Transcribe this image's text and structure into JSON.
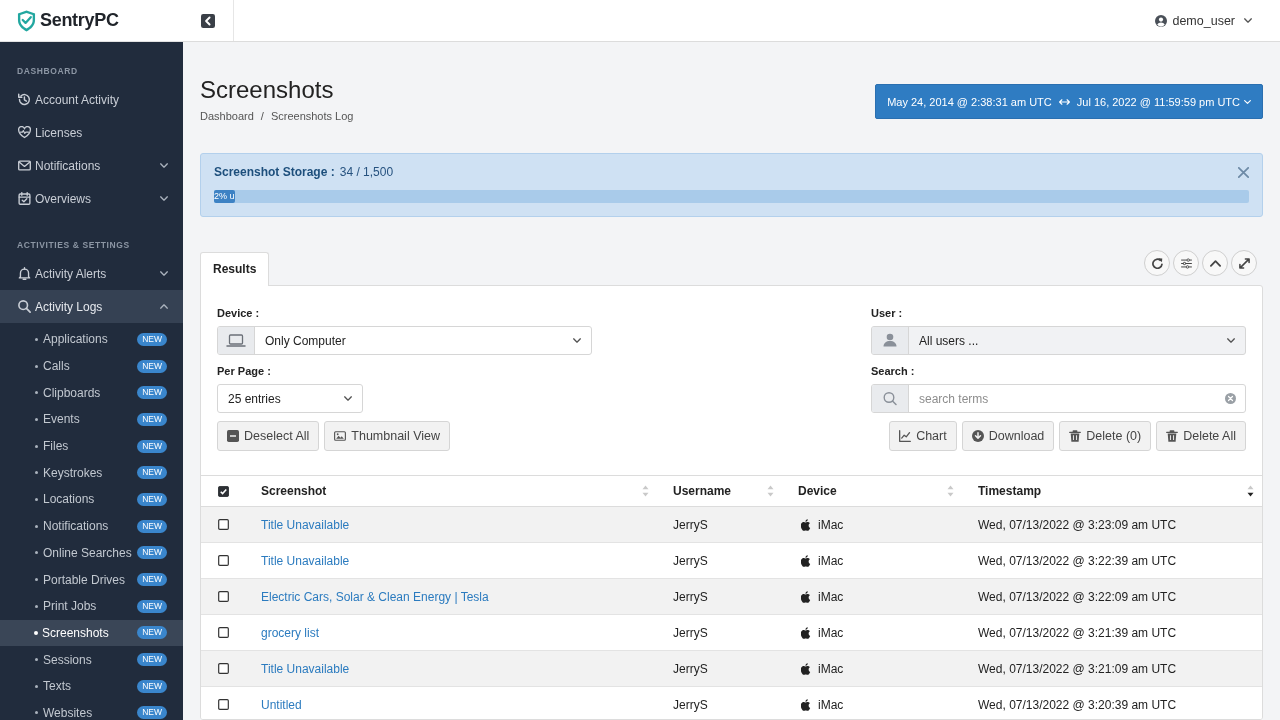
{
  "sidebar": {
    "brand": "SentryPC",
    "sections": [
      {
        "heading": "DASHBOARD",
        "items": [
          {
            "label": "Account Activity",
            "kind": "link"
          },
          {
            "label": "Licenses",
            "kind": "link"
          },
          {
            "label": "Notifications",
            "kind": "group",
            "expanded": false
          },
          {
            "label": "Overviews",
            "kind": "group",
            "expanded": false
          }
        ]
      },
      {
        "heading": "ACTIVITIES & SETTINGS",
        "items": [
          {
            "label": "Activity Alerts",
            "kind": "group",
            "expanded": false
          },
          {
            "label": "Activity Logs",
            "kind": "group",
            "expanded": true,
            "children": [
              {
                "label": "Applications",
                "badge": "NEW",
                "selected": false
              },
              {
                "label": "Calls",
                "badge": "NEW",
                "selected": false
              },
              {
                "label": "Clipboards",
                "badge": "NEW",
                "selected": false
              },
              {
                "label": "Events",
                "badge": "NEW",
                "selected": false
              },
              {
                "label": "Files",
                "badge": "NEW",
                "selected": false
              },
              {
                "label": "Keystrokes",
                "badge": "NEW",
                "selected": false
              },
              {
                "label": "Locations",
                "badge": "NEW",
                "selected": false
              },
              {
                "label": "Notifications",
                "badge": "NEW",
                "selected": false
              },
              {
                "label": "Online Searches",
                "badge": "NEW",
                "selected": false
              },
              {
                "label": "Portable Drives",
                "badge": "NEW",
                "selected": false
              },
              {
                "label": "Print Jobs",
                "badge": "NEW",
                "selected": false
              },
              {
                "label": "Screenshots",
                "badge": "NEW",
                "selected": true
              },
              {
                "label": "Sessions",
                "badge": "NEW",
                "selected": false
              },
              {
                "label": "Texts",
                "badge": "NEW",
                "selected": false
              },
              {
                "label": "Websites",
                "badge": "NEW",
                "selected": false
              }
            ]
          }
        ]
      }
    ]
  },
  "topbar": {
    "user": "demo_user"
  },
  "page_header": {
    "title": "Screenshots",
    "breadcrumb": [
      {
        "label": "Dashboard"
      },
      {
        "label": "Screenshots Log"
      }
    ],
    "breadcrumb_separator": "/",
    "date_range": {
      "start": "May 24, 2014 @ 2:38:31 am UTC",
      "end": "Jul 16, 2022 @ 11:59:59 pm UTC"
    }
  },
  "storage_alert": {
    "label": "Screenshot Storage :",
    "value": "34 / 1,500",
    "level": 0.02,
    "bar_text": "2% u"
  },
  "panel": {
    "tabs": [
      {
        "label": "Results",
        "selected": true
      }
    ],
    "filters": {
      "device": {
        "label": "Device :",
        "value": "Only Computer",
        "disabled": false
      },
      "per_page": {
        "label": "Per Page :",
        "value": "25 entries",
        "disabled": false
      },
      "user": {
        "label": "User :",
        "value": "All users ...",
        "disabled": true
      },
      "search": {
        "label": "Search :",
        "placeholder": "search terms"
      }
    },
    "left_buttons": [
      {
        "label": "Deselect All"
      },
      {
        "label": "Thumbnail View"
      }
    ],
    "right_buttons": [
      {
        "label": "Chart"
      },
      {
        "label": "Download"
      },
      {
        "label": "Delete (0)"
      },
      {
        "label": "Delete All"
      }
    ],
    "table": {
      "select_all": {
        "checked": true
      },
      "columns": [
        {
          "label": "Screenshot",
          "sorted": false
        },
        {
          "label": "Username",
          "sorted": false
        },
        {
          "label": "Device",
          "sorted": false
        },
        {
          "label": "Timestamp",
          "sorted": true
        }
      ],
      "rows": [
        {
          "checked": false,
          "screenshot": "Title Unavailable",
          "username": "JerryS",
          "device": "iMac",
          "timestamp": "Wed, 07/13/2022 @ 3:23:09 am UTC"
        },
        {
          "checked": false,
          "screenshot": "Title Unavailable",
          "username": "JerryS",
          "device": "iMac",
          "timestamp": "Wed, 07/13/2022 @ 3:22:39 am UTC"
        },
        {
          "checked": false,
          "screenshot": "Electric Cars, Solar & Clean Energy | Tesla",
          "username": "JerryS",
          "device": "iMac",
          "timestamp": "Wed, 07/13/2022 @ 3:22:09 am UTC"
        },
        {
          "checked": false,
          "screenshot": "grocery list",
          "username": "JerryS",
          "device": "iMac",
          "timestamp": "Wed, 07/13/2022 @ 3:21:39 am UTC"
        },
        {
          "checked": false,
          "screenshot": "Title Unavailable",
          "username": "JerryS",
          "device": "iMac",
          "timestamp": "Wed, 07/13/2022 @ 3:21:09 am UTC"
        },
        {
          "checked": false,
          "screenshot": "Untitled",
          "username": "JerryS",
          "device": "iMac",
          "timestamp": "Wed, 07/13/2022 @ 3:20:39 am UTC"
        }
      ]
    }
  }
}
